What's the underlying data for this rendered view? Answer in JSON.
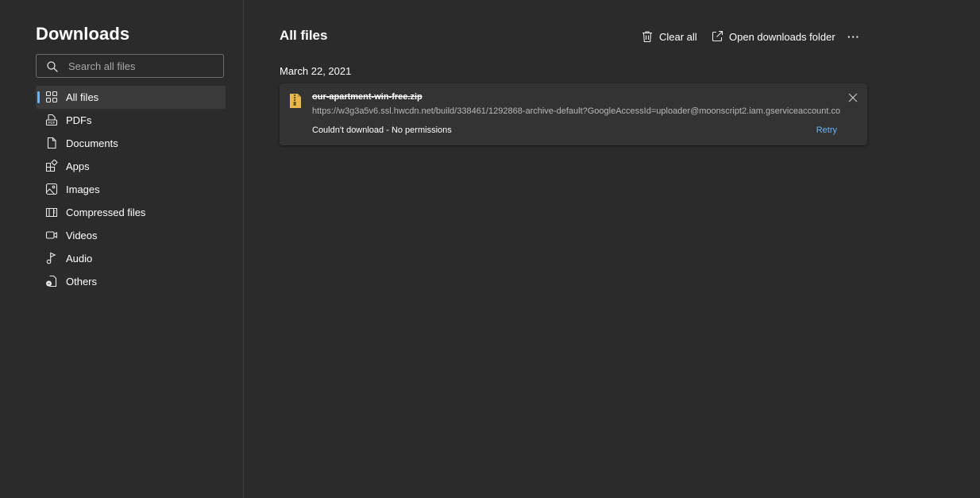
{
  "sidebar": {
    "title": "Downloads",
    "search_placeholder": "Search all files",
    "search_value": "",
    "items": [
      {
        "label": "All files",
        "icon": "grid-icon",
        "active": true
      },
      {
        "label": "PDFs",
        "icon": "pdf-icon"
      },
      {
        "label": "Documents",
        "icon": "document-icon"
      },
      {
        "label": "Apps",
        "icon": "apps-icon"
      },
      {
        "label": "Images",
        "icon": "image-icon"
      },
      {
        "label": "Compressed files",
        "icon": "compressed-icon"
      },
      {
        "label": "Videos",
        "icon": "video-icon"
      },
      {
        "label": "Audio",
        "icon": "audio-icon"
      },
      {
        "label": "Others",
        "icon": "others-icon"
      }
    ]
  },
  "main": {
    "title": "All files",
    "toolbar": {
      "clear_all": "Clear all",
      "open_folder": "Open downloads folder",
      "more": "···"
    },
    "groups": [
      {
        "date": "March 22, 2021",
        "files": [
          {
            "name": "our-apartment-win-free.zip",
            "url": "https://w3g3a5v6.ssl.hwcdn.net/build/338461/1292868-archive-default?GoogleAccessId=uploader@moonscript2.iam.gserviceaccount.co...",
            "status": "Couldn't download - No permissions",
            "action": "Retry",
            "icon": "zip-file-icon"
          }
        ]
      }
    ]
  },
  "colors": {
    "background": "#2b2b2b",
    "card": "#333333",
    "accent": "#6cb4f5",
    "active_item": "#3b3b3b"
  }
}
